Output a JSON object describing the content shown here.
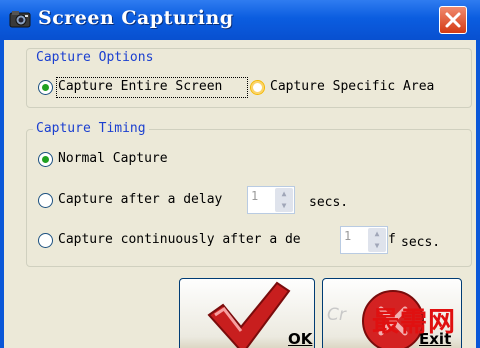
{
  "window": {
    "title": "Screen Capturing",
    "icon": "camera-icon",
    "close_icon": "close-icon"
  },
  "capture_options": {
    "legend": "Capture Options",
    "entire_screen_label": "Capture Entire Screen",
    "specific_area_label": "Capture Specific Area",
    "selected": "entire_screen"
  },
  "capture_timing": {
    "legend": "Capture Timing",
    "normal_label": "Normal Capture",
    "delay_label": "Capture after a delay",
    "delay_value": "1",
    "delay_unit": "secs.",
    "continuous_label": "Capture continuously after a de",
    "continuous_value": "1",
    "continuous_suffix": "f",
    "continuous_unit": "secs.",
    "selected": "normal"
  },
  "buttons": {
    "ok_label": "OK",
    "exit_label": "Exit"
  },
  "watermark": {
    "text": "最需网",
    "faint_text": "Cr"
  },
  "colors": {
    "title_bar": "#0b5de0",
    "legend_text": "#1c40d0",
    "radio_selected": "#21a121",
    "close_button": "#d43a14",
    "watermark": "#e01010"
  }
}
